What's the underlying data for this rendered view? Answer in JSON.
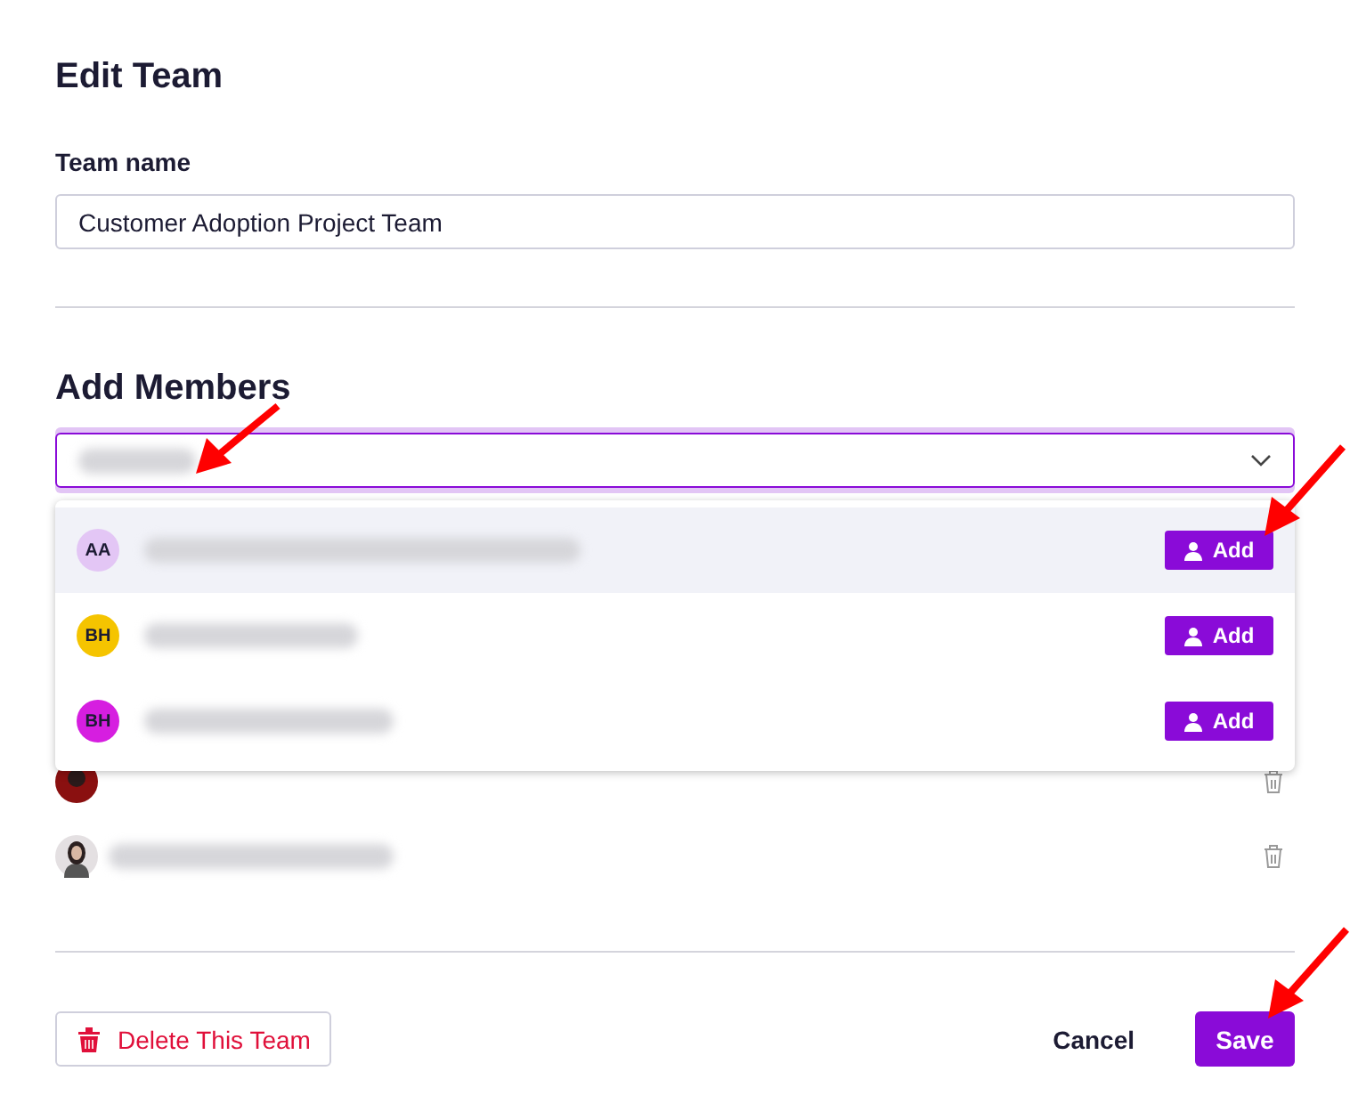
{
  "title": "Edit Team",
  "team_name": {
    "label": "Team name",
    "value": "Customer Adoption Project Team"
  },
  "add_members": {
    "heading": "Add Members",
    "results": [
      {
        "initials": "AA",
        "color": "#e3c6f5",
        "highlighted": true,
        "action": "Add"
      },
      {
        "initials": "BH",
        "color": "#f5c400",
        "highlighted": false,
        "action": "Add"
      },
      {
        "initials": "BH",
        "color": "#d61ee0",
        "highlighted": false,
        "action": "Add"
      }
    ]
  },
  "footer": {
    "delete": "Delete This Team",
    "cancel": "Cancel",
    "save": "Save"
  }
}
